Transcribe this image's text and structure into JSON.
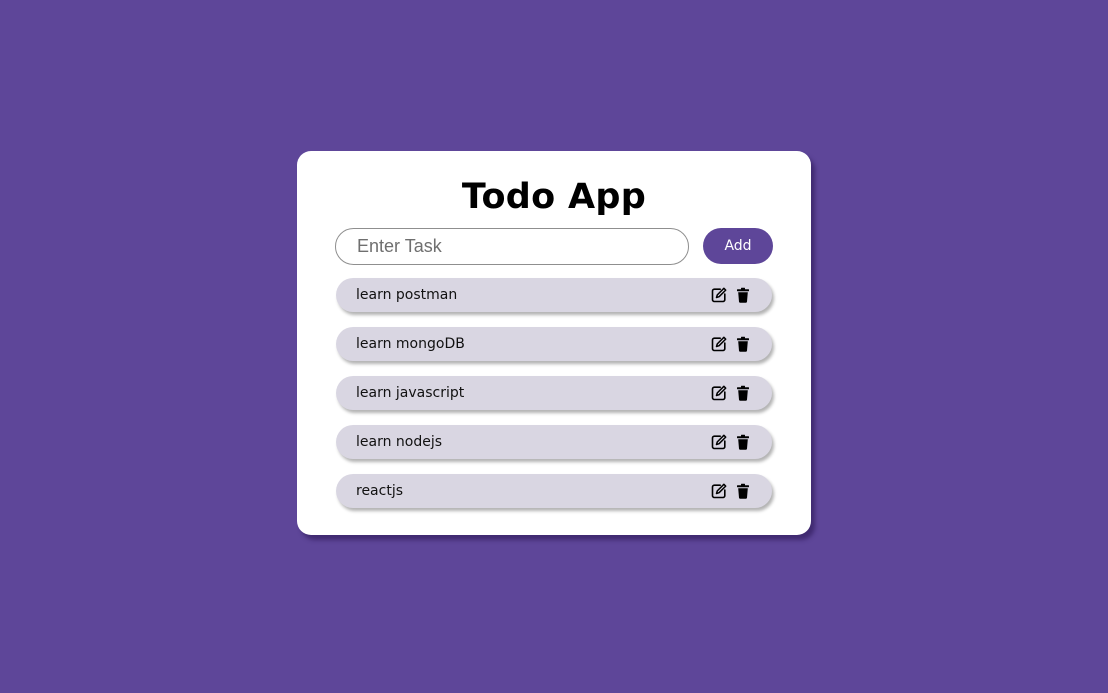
{
  "app": {
    "title": "Todo App"
  },
  "form": {
    "input_placeholder": "Enter Task",
    "input_value": "",
    "add_label": "Add"
  },
  "tasks": [
    {
      "text": "learn postman",
      "edit_icon": "edit-icon",
      "delete_icon": "trash-icon"
    },
    {
      "text": "learn mongoDB",
      "edit_icon": "edit-icon",
      "delete_icon": "trash-icon"
    },
    {
      "text": "learn javascript",
      "edit_icon": "edit-icon",
      "delete_icon": "trash-icon"
    },
    {
      "text": "learn nodejs",
      "edit_icon": "edit-icon",
      "delete_icon": "trash-icon"
    },
    {
      "text": "reactjs",
      "edit_icon": "edit-icon",
      "delete_icon": "trash-icon"
    }
  ],
  "colors": {
    "background": "#5e4699",
    "card": "#ffffff",
    "accent": "#5e4699",
    "task_background": "#d9d6e2"
  }
}
